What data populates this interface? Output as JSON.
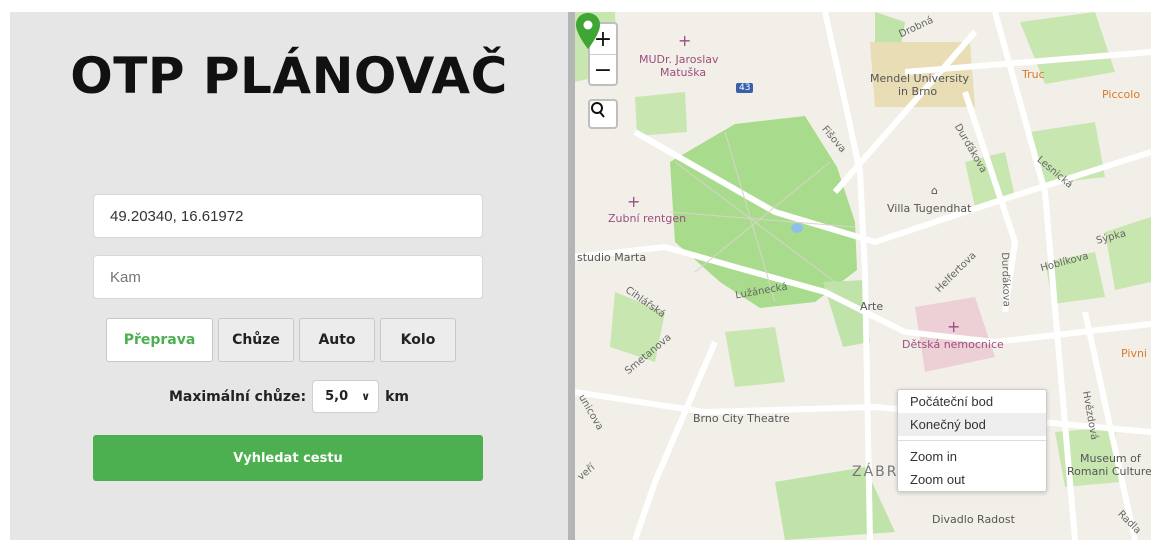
{
  "app": {
    "title": "OTP PLÁNOVAČ"
  },
  "inputs": {
    "from_value": "49.20340, 16.61972",
    "to_placeholder": "Kam"
  },
  "modes": [
    "Přeprava",
    "Chůze",
    "Auto",
    "Kolo"
  ],
  "walk": {
    "label": "Maximální chůze:",
    "value": "5,0",
    "unit": "km"
  },
  "search_button": "Vyhledat cestu",
  "map": {
    "zoom_in": "+",
    "zoom_out": "−",
    "labels": {
      "drobna": "Drobná",
      "mudr": "MUDr. Jaroslav",
      "matuska": "Matuška",
      "route43": "43",
      "mendel1": "Mendel University",
      "mendel2": "in Brno",
      "truc": "Truc",
      "piccolo": "Piccolo",
      "fisova": "Fišova",
      "durdakova1": "Durďákova",
      "lesnicka": "Lesnická",
      "zubni": "Zubní rentgen",
      "villa": "Villa Tugendhat",
      "studio": "studio Marta",
      "sypka": "Sýpka",
      "hoblikova": "Hoblíkova",
      "durdakova2": "Durďákova",
      "helfertova": "Helfertova",
      "cihlarska": "Cihlářská",
      "luzanecka": "Lužánecká",
      "arte": "Arte",
      "detska": "Dětská nemocnice",
      "pivni": "Pivni",
      "smetanova": "Smetanova",
      "unicova": "unicova",
      "theatre": "Brno City Theatre",
      "hvezdova": "Hvězdová",
      "museum1": "Museum of",
      "museum2": "Romani Culture",
      "zabr": "ZÁBR",
      "radost": "Divadlo Radost",
      "veri": "veří",
      "radla": "Radla"
    },
    "context_menu": [
      "Počáteční bod",
      "Konečný bod",
      "Zoom in",
      "Zoom out"
    ]
  },
  "colors": {
    "accent": "#4caf50",
    "park": "#a8dc8c",
    "pin": "#3fa535"
  }
}
